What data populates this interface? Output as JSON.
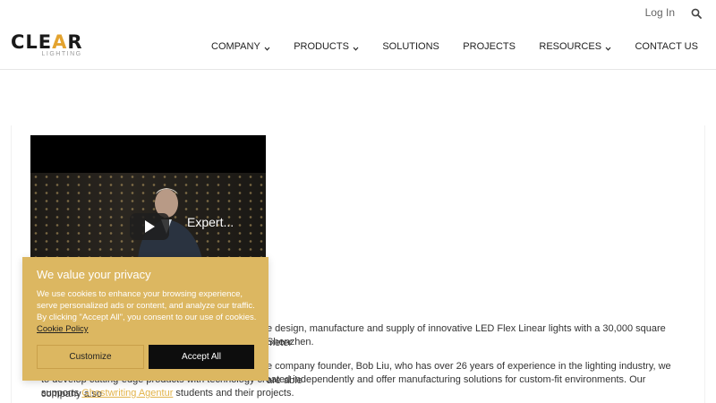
{
  "header": {
    "login_label": "Log In",
    "logo": {
      "main_left": "CLE",
      "main_accent": "A",
      "main_right": "R",
      "sub": "LIGHTING"
    },
    "nav": [
      {
        "label": "COMPANY",
        "dropdown": true
      },
      {
        "label": "PRODUCTS",
        "dropdown": true
      },
      {
        "label": "SOLUTIONS",
        "dropdown": false
      },
      {
        "label": "PROJECTS",
        "dropdown": false
      },
      {
        "label": "RESOURCES",
        "dropdown": true
      },
      {
        "label": "CONTACT US",
        "dropdown": false
      }
    ]
  },
  "video": {
    "title": "Expert..."
  },
  "content": {
    "p1_line1": "e design, manufacture and supply of innovative LED Flex Linear lights with a 30,000 square meter",
    "p1_line2": "Shenzhen.",
    "p2_line1": "e company founder, Bob Liu, who has over 26 years of experience in the lighting industry, we are able",
    "p3_line": "to develop cutting-edge products with technology created independently and offer manufacturing solutions for custom-fit environments. Our company also",
    "p4_prefix": "supports ",
    "p4_link": "Ghostwriting Agentur",
    "p4_suffix": " students and their projects."
  },
  "cookie": {
    "title": "We value your privacy",
    "text": "We use cookies to enhance your browsing experience, serve personalized ads or content, and analyze our traffic. By clicking \"Accept All\", you consent to our use of cookies.",
    "policy_link": "Cookie Policy",
    "customize_label": "Customize",
    "accept_label": "Accept All"
  },
  "colors": {
    "accent": "#e3a32f",
    "cookie_bg": "#dcb761",
    "link": "#e2b34a"
  }
}
